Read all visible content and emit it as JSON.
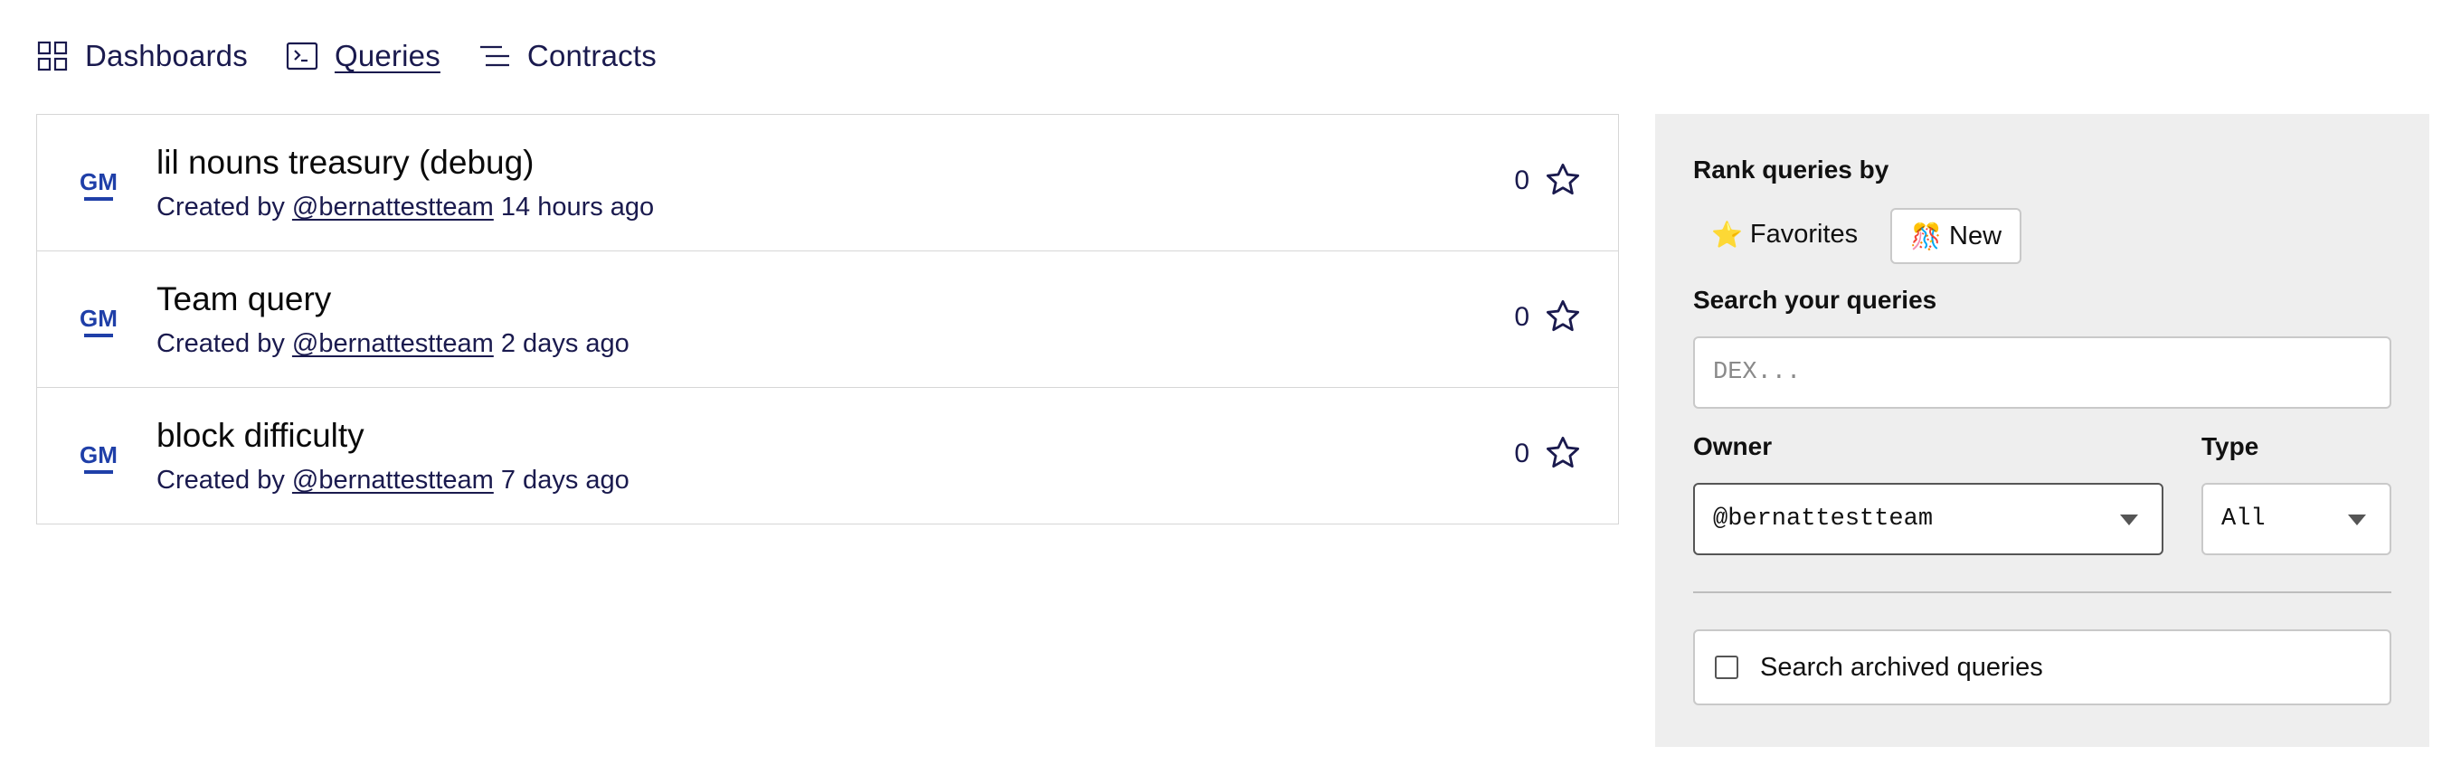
{
  "nav": {
    "items": [
      {
        "label": "Dashboards",
        "icon": "grid-icon",
        "active": false
      },
      {
        "label": "Queries",
        "icon": "terminal-icon",
        "active": true
      },
      {
        "label": "Contracts",
        "icon": "list-lines-icon",
        "active": false
      }
    ]
  },
  "queries": [
    {
      "logo": "GM",
      "title": "lil nouns treasury (debug)",
      "created_prefix": "Created by",
      "author": "@bernattestteam",
      "age": "14 hours ago",
      "stars": "0"
    },
    {
      "logo": "GM",
      "title": "Team query",
      "created_prefix": "Created by",
      "author": "@bernattestteam",
      "age": "2 days ago",
      "stars": "0"
    },
    {
      "logo": "GM",
      "title": "block difficulty",
      "created_prefix": "Created by",
      "author": "@bernattestteam",
      "age": "7 days ago",
      "stars": "0"
    }
  ],
  "panel": {
    "rank_label": "Rank queries by",
    "rank_options": [
      {
        "emoji": "⭐",
        "label": "Favorites",
        "selected": false
      },
      {
        "emoji": "🎊",
        "label": "New",
        "selected": true
      }
    ],
    "search_label": "Search your queries",
    "search_placeholder": "DEX...",
    "search_value": "",
    "owner_label": "Owner",
    "owner_value": "@bernattestteam",
    "type_label": "Type",
    "type_value": "All",
    "archived_label": "Search archived queries",
    "archived_checked": false
  },
  "colors": {
    "text_primary": "#0a0a33",
    "logo_blue": "#1f3fa8",
    "panel_bg": "#eeeeee"
  }
}
